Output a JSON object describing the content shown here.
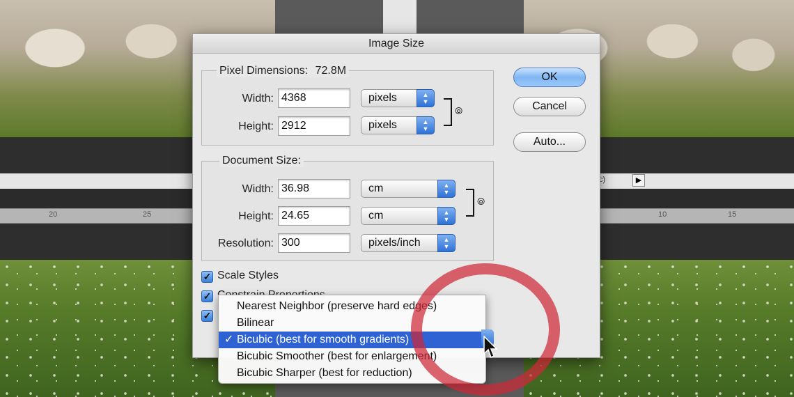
{
  "dialog": {
    "title": "Image Size",
    "pixel_dimensions": {
      "title": "Pixel Dimensions:",
      "size": "72.8M",
      "width_label": "Width:",
      "width_value": "4368",
      "width_unit": "pixels",
      "height_label": "Height:",
      "height_value": "2912",
      "height_unit": "pixels"
    },
    "document_size": {
      "title": "Document Size:",
      "width_label": "Width:",
      "width_value": "36.98",
      "width_unit": "cm",
      "height_label": "Height:",
      "height_value": "24.65",
      "height_unit": "cm",
      "resolution_label": "Resolution:",
      "resolution_value": "300",
      "resolution_unit": "pixels/inch"
    },
    "buttons": {
      "ok": "OK",
      "cancel": "Cancel",
      "auto": "Auto..."
    },
    "checkboxes": {
      "scale_styles": "Scale Styles",
      "constrain_proportions": "Constrain Proportions"
    },
    "resample_menu": {
      "items": [
        "Nearest Neighbor (preserve hard edges)",
        "Bilinear",
        "Bicubic (best for smooth gradients)",
        "Bicubic Smoother (best for enlargement)",
        "Bicubic Sharper (best for reduction)"
      ],
      "selected_check": "✓"
    }
  },
  "workspace": {
    "ruler_labels": [
      "20",
      "25",
      "10",
      "15"
    ],
    "panel_fragment": "c)"
  },
  "icons": [
    "chain-link-icon",
    "popup-arrows-icon",
    "checkmark-icon",
    "mouse-pointer-icon",
    "play-arrow-icon"
  ],
  "colors": {
    "selection": "#2f63d4",
    "annotation_ring": "#cd2837",
    "default_button": "#7fb6f3"
  }
}
